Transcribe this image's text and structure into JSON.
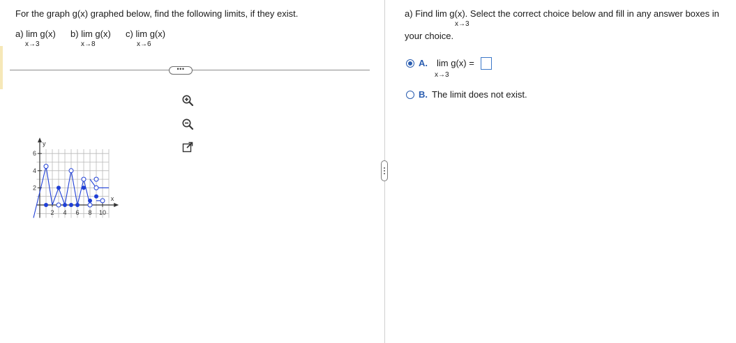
{
  "left": {
    "question": "For the graph g(x) graphed below, find the following limits, if they exist.",
    "parts": [
      {
        "prefix": "a)",
        "lim": "lim",
        "func": "g(x)",
        "sub": "x→3"
      },
      {
        "prefix": "b)",
        "lim": "lim",
        "func": "g(x)",
        "sub": "x→8"
      },
      {
        "prefix": "c)",
        "lim": "lim",
        "func": "g(x)",
        "sub": "x→6"
      }
    ],
    "more_label": "•••",
    "tools": [
      "zoom-in-icon",
      "zoom-out-icon",
      "open-new-window-icon"
    ]
  },
  "graph": {
    "y_axis_label": "y",
    "x_axis_label": "x",
    "x_tick_labels": [
      "2",
      "4",
      "6",
      "8",
      "10"
    ],
    "y_tick_labels": [
      "2",
      "4",
      "6"
    ],
    "x_range": [
      -1,
      11
    ],
    "y_range": [
      -1.5,
      6.5
    ],
    "line_color": "#1f3fd6",
    "segments": [
      {
        "x": [
          -1,
          1
        ],
        "y": [
          -1.5,
          4.5
        ]
      },
      {
        "x": [
          1,
          2
        ],
        "y": [
          4.5,
          0
        ]
      },
      {
        "x": [
          2,
          3
        ],
        "y": [
          0,
          2
        ]
      },
      {
        "x": [
          3,
          4
        ],
        "y": [
          2,
          0
        ]
      },
      {
        "x": [
          4,
          5
        ],
        "y": [
          0,
          4
        ]
      },
      {
        "x": [
          5,
          6
        ],
        "y": [
          4,
          0
        ]
      },
      {
        "x": [
          6,
          7
        ],
        "y": [
          0,
          3
        ]
      },
      {
        "x": [
          7,
          8
        ],
        "y": [
          3,
          0
        ]
      },
      {
        "x": [
          8,
          9
        ],
        "y": [
          3,
          2
        ]
      },
      {
        "x": [
          9,
          11
        ],
        "y": [
          2,
          2
        ]
      },
      {
        "x": [
          9,
          10
        ],
        "y": [
          0.5,
          0.5
        ]
      }
    ],
    "closed_points": [
      [
        1,
        0
      ],
      [
        3,
        2
      ],
      [
        4,
        0
      ],
      [
        5,
        0
      ],
      [
        6,
        0
      ],
      [
        7,
        2
      ],
      [
        8,
        0.5
      ],
      [
        9,
        1
      ]
    ],
    "open_points": [
      [
        1,
        4.5
      ],
      [
        5,
        4
      ],
      [
        7,
        3
      ],
      [
        8,
        0
      ],
      [
        9,
        3
      ],
      [
        9,
        2
      ],
      [
        10,
        0.5
      ],
      [
        3,
        0
      ]
    ]
  },
  "right": {
    "question_a": "a) Find  lim  g(x). Select the correct choice below and fill in any answer boxes in",
    "question_a_sub": "x→3",
    "question_a2": "your choice.",
    "choice_a_letter": "A.",
    "choice_a_text": "lim  g(x) =",
    "choice_a_sub": "x→3",
    "choice_b_letter": "B.",
    "choice_b_text": "The limit does not exist.",
    "answer_value": ""
  }
}
